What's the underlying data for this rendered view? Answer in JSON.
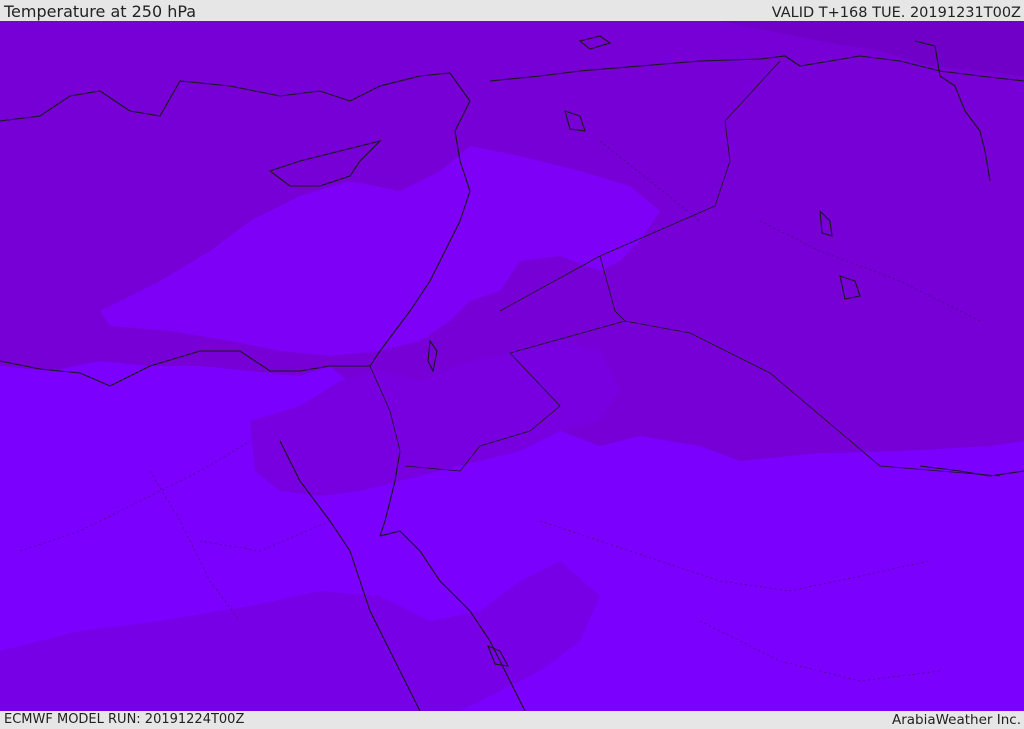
{
  "header": {
    "title": "Temperature at 250 hPa",
    "valid": "VALID T+168 TUE. 20191231T00Z"
  },
  "footer": {
    "model_run": "ECMWF MODEL RUN: 20191224T00Z",
    "credit": "ArabiaWeather Inc."
  },
  "map": {
    "field": "temperature",
    "level": "250 hPa",
    "region": "Eastern Mediterranean / Middle East",
    "colors": {
      "cold_band": "#7a00d8",
      "mid_band": "#7d00f0",
      "warm_band": "#7a00ff",
      "coast": "#1a1a1a"
    }
  }
}
